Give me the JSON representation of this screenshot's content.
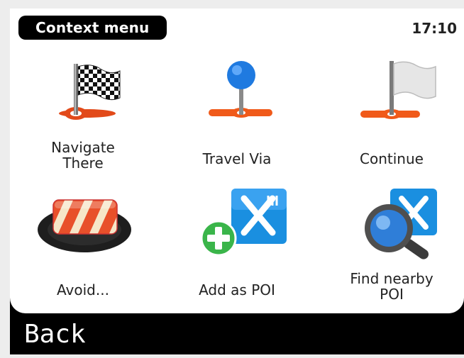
{
  "header": {
    "title": "Context menu",
    "time": "17:10"
  },
  "menu": {
    "items": [
      {
        "id": "navigate",
        "label_lines": [
          "Navigate",
          "There"
        ],
        "icon": "checkered-flag-icon"
      },
      {
        "id": "travel-via",
        "label_lines": [
          "Travel Via"
        ],
        "icon": "map-pin-icon"
      },
      {
        "id": "continue",
        "label_lines": [
          "Continue"
        ],
        "icon": "white-flag-icon"
      },
      {
        "id": "avoid",
        "label_lines": [
          "Avoid..."
        ],
        "icon": "roadblock-icon"
      },
      {
        "id": "add-poi",
        "label_lines": [
          "Add as POI"
        ],
        "icon": "add-poi-icon"
      },
      {
        "id": "find-poi",
        "label_lines": [
          "Find nearby",
          "POI"
        ],
        "icon": "find-poi-icon"
      }
    ]
  },
  "footer": {
    "back_label": "Back"
  },
  "colors": {
    "accent_orange": "#f05a1a",
    "pin_blue": "#1f7ae0",
    "poi_blue": "#1a8fe0",
    "add_green": "#3ab54a"
  }
}
